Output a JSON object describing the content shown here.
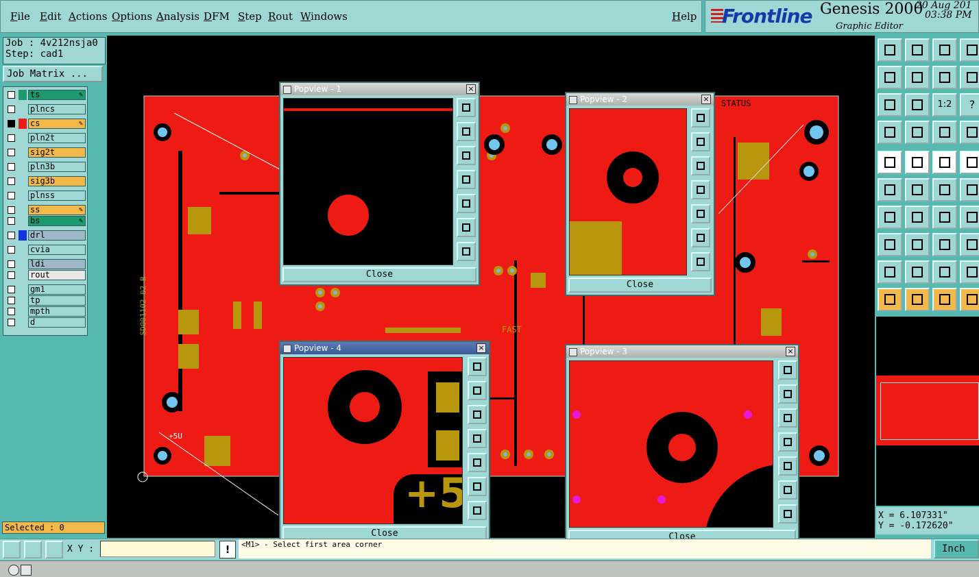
{
  "menu": {
    "items": [
      "File",
      "Edit",
      "Actions",
      "Options",
      "Analysis",
      "DFM",
      "Step",
      "Rout",
      "Windows"
    ],
    "help": "Help"
  },
  "brand": {
    "logo": "Frontline",
    "product": "Genesis 2000",
    "subtitle": "Graphic Editor",
    "date": "20 Aug 201",
    "time": "03:38 PM"
  },
  "job": {
    "job_label": "Job : 4v212nsja0",
    "step_label": "Step: cad1",
    "matrix_button": "Job Matrix ..."
  },
  "layers": [
    {
      "name": "ts",
      "color": "#1e9a6e",
      "swatch": "#1e9a6e",
      "edit": true
    },
    {
      "name": "plncs",
      "color": "#9fd7d5",
      "swatch": "",
      "edit": false
    },
    {
      "name": "cs",
      "color": "#f3b84a",
      "swatch": "#ee1a14",
      "edit": true,
      "active": true
    },
    {
      "name": "pln2t",
      "color": "#9fd7d5",
      "swatch": "",
      "edit": false
    },
    {
      "name": "sig2t",
      "color": "#f3b84a",
      "swatch": "",
      "edit": false
    },
    {
      "name": "pln3b",
      "color": "#9fd7d5",
      "swatch": "",
      "edit": false
    },
    {
      "name": "sig3b",
      "color": "#f3b84a",
      "swatch": "",
      "edit": false
    },
    {
      "name": "plnss",
      "color": "#9fd7d5",
      "swatch": "",
      "edit": false
    },
    {
      "name": "ss",
      "color": "#f3b84a",
      "swatch": "",
      "edit": true
    },
    {
      "name": "bs",
      "color": "#1e9a6e",
      "swatch": "",
      "edit": true
    },
    {
      "name": "drl",
      "color": "#9fb8c8",
      "swatch": "#1432e0",
      "edit": false
    },
    {
      "name": "cvia",
      "color": "#9fd7d5",
      "swatch": "",
      "edit": false
    },
    {
      "name": "ldi",
      "color": "#9fb8c8",
      "swatch": "",
      "edit": false
    },
    {
      "name": "rout",
      "color": "#e8e8e8",
      "swatch": "",
      "edit": false
    },
    {
      "name": "gm1",
      "color": "#9fd7d5",
      "swatch": "",
      "edit": false
    },
    {
      "name": "tp",
      "color": "#9fd7d5",
      "swatch": "",
      "edit": false
    },
    {
      "name": "mpth",
      "color": "#9fd7d5",
      "swatch": "",
      "edit": false
    },
    {
      "name": "d",
      "color": "#9fd7d5",
      "swatch": "",
      "edit": false
    }
  ],
  "board_text": {
    "status": "STATUS",
    "fast": "FAST",
    "plus5v": "+5U",
    "vertical": "SD001102 02 B"
  },
  "popups": [
    {
      "title": "Popview - 1",
      "close": "Close"
    },
    {
      "title": "Popview - 2",
      "close": "Close"
    },
    {
      "title": "Popview - 4",
      "close": "Close"
    },
    {
      "title": "Popview - 3",
      "close": "Close"
    }
  ],
  "right_toolbar": {
    "scale_label": "1:2",
    "help_label": "?"
  },
  "coords": {
    "x": "X =  6.107331\"",
    "y": "Y = -0.172620\""
  },
  "status": {
    "selected": "Selected : 0",
    "xy_label": "X Y :",
    "xy_value": "",
    "warn": "!",
    "message": "<M1> - Select first area corner",
    "unit": "Inch"
  },
  "colors": {
    "copper": "#ee1a14",
    "pad": "#b8960e",
    "panel": "#9fd7d5",
    "background": "#57b9b0",
    "orange": "#f3b84a"
  }
}
